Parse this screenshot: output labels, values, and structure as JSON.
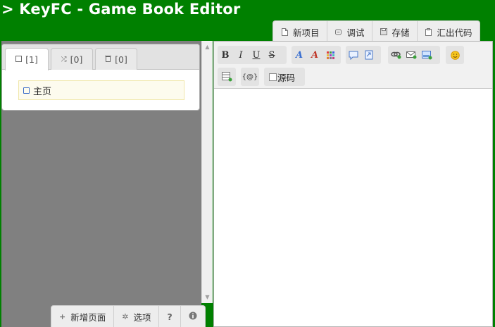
{
  "app": {
    "title": "> KeyFC - Game Book Editor"
  },
  "top_toolbar": [
    {
      "label": "新项目",
      "icon": "new-file-icon"
    },
    {
      "label": "调试",
      "icon": "debug-icon"
    },
    {
      "label": "存储",
      "icon": "save-icon"
    },
    {
      "label": "汇出代码",
      "icon": "clipboard-icon"
    }
  ],
  "tabs": [
    {
      "label": "[1]",
      "icon": "page-icon",
      "active": true
    },
    {
      "label": "[0]",
      "icon": "shuffle-icon",
      "active": false
    },
    {
      "label": "[0]",
      "icon": "trash-icon",
      "active": false
    }
  ],
  "pages": [
    {
      "label": "主页",
      "icon": "page-icon"
    }
  ],
  "bottom_toolbar": [
    {
      "label": "新增页面",
      "icon": "plus-icon"
    },
    {
      "label": "选项",
      "icon": "gear-icon"
    },
    {
      "label": "?",
      "icon": "help-icon"
    },
    {
      "label": "",
      "icon": "info-icon"
    }
  ],
  "editor": {
    "toolbar": {
      "format": [
        "B",
        "I",
        "U",
        "S"
      ],
      "text_color_glyphs": [
        "A",
        "A"
      ],
      "source_label": "源码",
      "source_checked": false
    },
    "content": ""
  }
}
